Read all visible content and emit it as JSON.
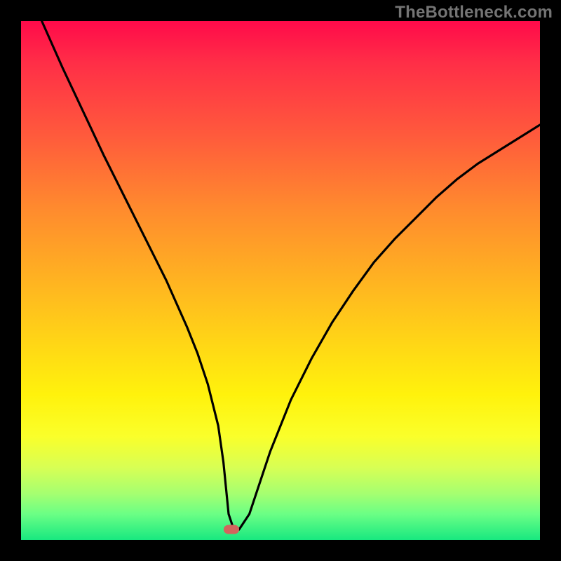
{
  "watermark": "TheBottleneck.com",
  "chart_data": {
    "type": "line",
    "title": "",
    "xlabel": "",
    "ylabel": "",
    "xlim": [
      0,
      100
    ],
    "ylim": [
      0,
      100
    ],
    "grid": false,
    "legend": false,
    "series": [
      {
        "name": "curve",
        "x": [
          4,
          8,
          12,
          16,
          20,
          24,
          28,
          32,
          34,
          36,
          38,
          39,
          40,
          41,
          42,
          44,
          48,
          52,
          56,
          60,
          64,
          68,
          72,
          76,
          80,
          84,
          88,
          92,
          96,
          100
        ],
        "y": [
          100,
          91,
          82.5,
          74,
          66,
          58,
          50,
          41,
          36,
          30,
          22,
          15,
          5,
          2,
          2,
          5,
          17,
          27,
          35,
          42,
          48,
          53.5,
          58,
          62,
          66,
          69.5,
          72.5,
          75,
          77.5,
          80
        ]
      }
    ],
    "marker": {
      "x": 40.5,
      "y": 2
    },
    "gradient_stops": [
      {
        "pos": 0,
        "color": "#ff0a4a"
      },
      {
        "pos": 8,
        "color": "#ff2e47"
      },
      {
        "pos": 22,
        "color": "#ff5a3c"
      },
      {
        "pos": 36,
        "color": "#ff8a2e"
      },
      {
        "pos": 50,
        "color": "#ffb321"
      },
      {
        "pos": 62,
        "color": "#ffd616"
      },
      {
        "pos": 72,
        "color": "#fff20c"
      },
      {
        "pos": 80,
        "color": "#faff2a"
      },
      {
        "pos": 86,
        "color": "#d8ff54"
      },
      {
        "pos": 91,
        "color": "#a6ff70"
      },
      {
        "pos": 95,
        "color": "#6bff85"
      },
      {
        "pos": 100,
        "color": "#18e880"
      }
    ]
  }
}
